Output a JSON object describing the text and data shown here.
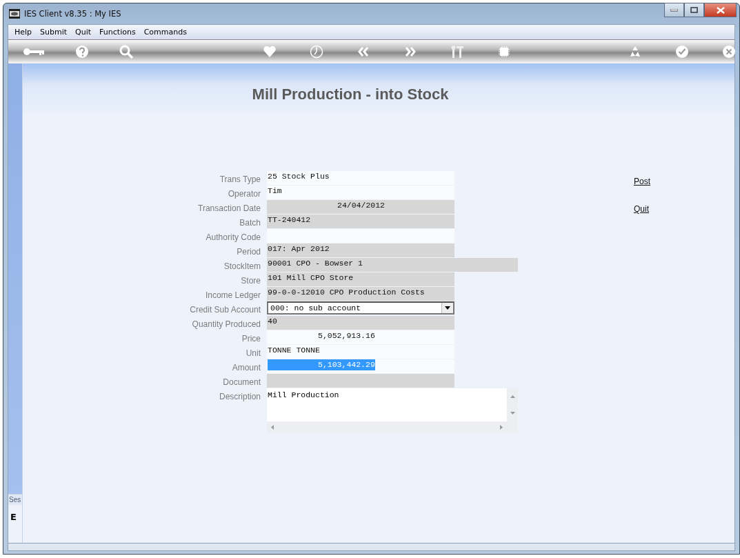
{
  "window": {
    "title": "IES Client v8.35 : My IES"
  },
  "menu": [
    "Help",
    "Submit",
    "Quit",
    "Functions",
    "Commands"
  ],
  "toolbar": [
    {
      "kind": "key"
    },
    {
      "kind": "help"
    },
    {
      "kind": "search"
    },
    {
      "kind": "heart"
    },
    {
      "kind": "clock"
    },
    {
      "kind": "back"
    },
    {
      "kind": "forward"
    },
    {
      "kind": "tools"
    },
    {
      "kind": "chip"
    },
    {
      "kind": "recycle"
    },
    {
      "kind": "check"
    },
    {
      "kind": "close"
    }
  ],
  "form": {
    "title": "Mill Production - into Stock",
    "fields": [
      {
        "label": "Trans Type",
        "kind": "text",
        "value": "25 Stock Plus",
        "readonly": false
      },
      {
        "label": "Operator",
        "kind": "text",
        "value": "Tim",
        "readonly": false
      },
      {
        "label": "Transaction Date",
        "kind": "date",
        "value": "24/04/2012",
        "readonly": true
      },
      {
        "label": "Batch",
        "kind": "text",
        "value": "TT-240412",
        "readonly": true
      },
      {
        "label": "Authority Code",
        "kind": "text",
        "readonly": false
      },
      {
        "label": "Period",
        "kind": "text",
        "value": "017: Apr 2012",
        "readonly": true
      },
      {
        "label": "StockItem",
        "kind": "wide",
        "value": "90001 CPO - Bowser 1",
        "readonly": true
      },
      {
        "label": "Store",
        "kind": "text",
        "value": "101 Mill CPO Store",
        "readonly": true
      },
      {
        "label": "Income Ledger",
        "kind": "text",
        "value": "99-0-0-12010 CPO Production Costs",
        "readonly": true
      },
      {
        "label": "Credit Sub Account",
        "kind": "select",
        "value": "000: no sub account"
      },
      {
        "label": "Quantity Produced",
        "kind": "text",
        "value": "40",
        "readonly": true
      },
      {
        "label": "Price",
        "kind": "number",
        "value": "5,052,913.16",
        "readonly": false
      },
      {
        "label": "Unit",
        "kind": "text",
        "value": "TONNE TONNE",
        "readonly": false
      },
      {
        "label": "Amount",
        "kind": "number",
        "value": "5,103,442.29",
        "readonly": false,
        "selected": true
      },
      {
        "label": "Document",
        "kind": "text",
        "readonly": true
      },
      {
        "label": "Description",
        "kind": "textarea",
        "value": "Mill Production"
      }
    ]
  },
  "actions": [
    "Post",
    "Quit"
  ],
  "session": {
    "label": "Ses",
    "glyph": "E"
  }
}
